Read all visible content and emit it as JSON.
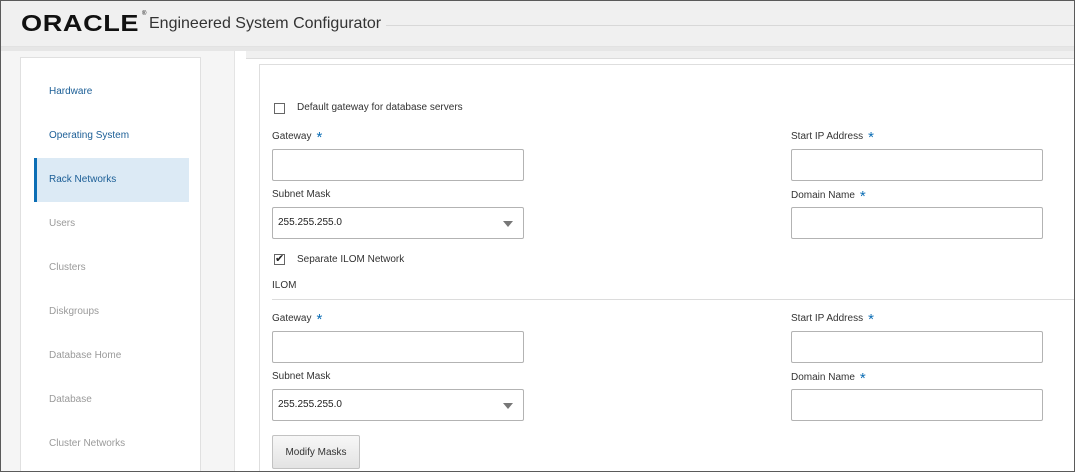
{
  "header": {
    "brand": "ORACLE",
    "brand_mark": "®",
    "title": "Engineered System Configurator"
  },
  "sidebar": {
    "items": [
      {
        "label": "Hardware",
        "state": "completed"
      },
      {
        "label": "Operating System",
        "state": "completed"
      },
      {
        "label": "Rack Networks",
        "state": "active"
      },
      {
        "label": "Users",
        "state": "pending"
      },
      {
        "label": "Clusters",
        "state": "pending"
      },
      {
        "label": "Diskgroups",
        "state": "pending"
      },
      {
        "label": "Database Home",
        "state": "pending"
      },
      {
        "label": "Database",
        "state": "pending"
      },
      {
        "label": "Cluster Networks",
        "state": "pending"
      }
    ]
  },
  "form": {
    "default_gateway_checkbox": {
      "label": "Default gateway for database servers",
      "checked": false
    },
    "gateway": {
      "label": "Gateway",
      "required_mark": "*",
      "value": ""
    },
    "start_ip": {
      "label": "Start IP Address",
      "required_mark": "*",
      "value": ""
    },
    "subnet_mask": {
      "label": "Subnet Mask",
      "value": "255.255.255.0"
    },
    "domain_name": {
      "label": "Domain Name",
      "required_mark": "*",
      "value": ""
    },
    "separate_ilom_checkbox": {
      "label": "Separate ILOM Network",
      "checked": true,
      "check_glyph": "✔"
    },
    "ilom": {
      "section_title": "ILOM",
      "gateway": {
        "label": "Gateway",
        "required_mark": "*",
        "value": ""
      },
      "start_ip": {
        "label": "Start IP Address",
        "required_mark": "*",
        "value": ""
      },
      "subnet_mask": {
        "label": "Subnet Mask",
        "value": "255.255.255.0"
      },
      "domain_name": {
        "label": "Domain Name",
        "required_mark": "*",
        "value": ""
      }
    },
    "modify_masks_button": "Modify Masks"
  },
  "colors": {
    "accent": "#0c6eb5",
    "link": "#1b5e96",
    "active_bg": "#dceaf5",
    "required": "#0b6db5"
  },
  "icons": {
    "dropdown": "chevron-down-icon",
    "checkbox_checked": "checkmark-icon"
  }
}
